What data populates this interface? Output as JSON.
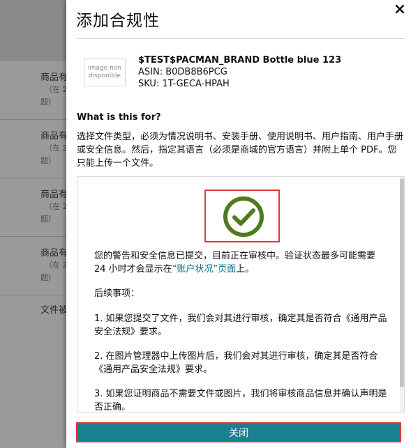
{
  "background": {
    "rows": [
      {
        "t1": "商品有",
        "t2": "（在 2",
        "t3": "题）"
      },
      {
        "t1": "商品有",
        "t2": "（在 2",
        "t3": "题）"
      },
      {
        "t1": "商品有",
        "t2": "（在 2",
        "t3": "题）"
      },
      {
        "t1": "商品有",
        "t2": "（在 2",
        "t3": "题）"
      },
      {
        "t1": "文件被",
        "t2": "",
        "t3": ""
      }
    ]
  },
  "modal": {
    "title": "添加合规性",
    "close_icon": "×",
    "product": {
      "image_placeholder": "Image non disponible",
      "title": "$TEST$PACMAN_BRAND Bottle blue 123",
      "asin": "ASIN: B0DB8B6PCG",
      "sku": "SKU: 1T-GECA-HPAH"
    },
    "what_heading": "What is this for?",
    "description": "选择文件类型，必须为情况说明书、安装手册、使用说明书、用户指南、用户手册或安全信息。然后，指定其语言（必须是商城的官方语言）并附上单个 PDF。您只能上传一个文件。",
    "status": {
      "icon": "check-circle-icon",
      "icon_color": "#507a1d",
      "text_before": "您的警告和安全信息已提交，目前正在审核中。验证状态最多可能需要 24 小时才会显示在",
      "link": "“账户状况”页面",
      "text_after": "上。"
    },
    "next_steps_heading": "后续事项：",
    "steps": [
      "1. 如果您提交了文件，我们会对其进行审核，确定其是否符合《通用产品安全法规》要求。",
      "2. 在图片管理器中上传图片后，我们会对其进行审核，确定其是否符合《通用产品安全法规》要求。",
      "3. 如果您证明商品不需要文件或图片，我们将审核商品信息并确认声明是否正确。"
    ],
    "close_button": "关闭",
    "accent_color": "#1a7f90"
  }
}
